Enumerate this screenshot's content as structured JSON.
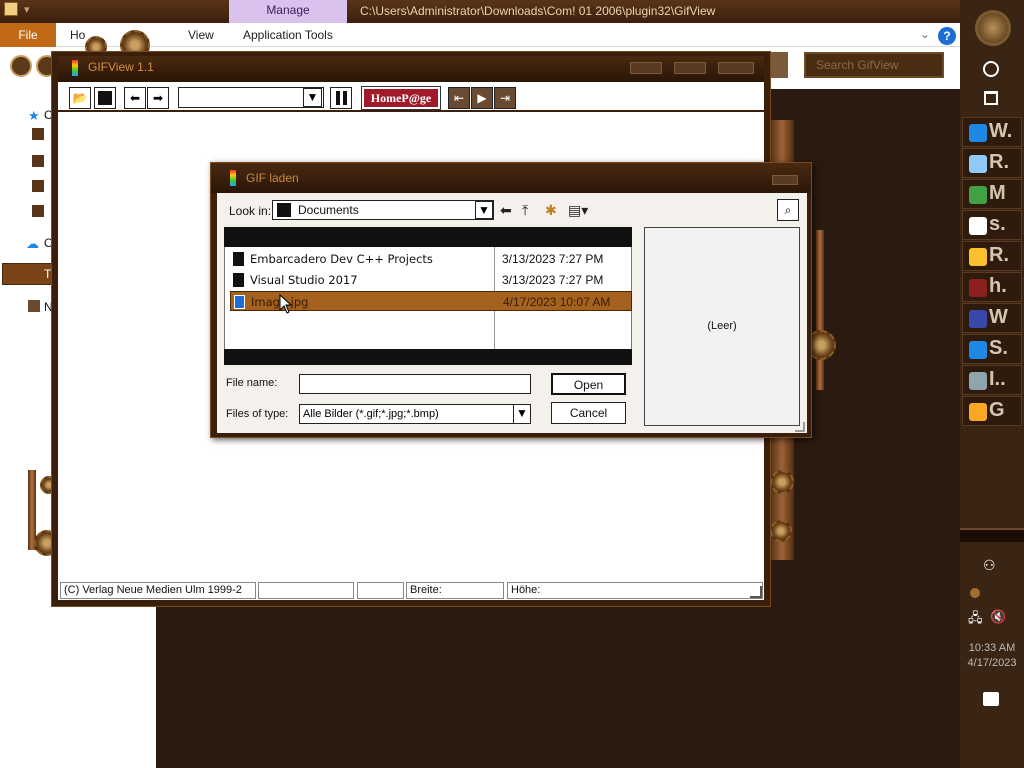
{
  "explorer": {
    "manage_tab": "Manage",
    "path_title": "C:\\Users\\Administrator\\Downloads\\Com! 01 2006\\plugin32\\GifView",
    "file_tab": "File",
    "view_tab": "View",
    "app_tools_tab": "Application Tools",
    "home_tab_partial": "Ho",
    "search_placeholder": "Search GifView",
    "help_label": "?",
    "left_items": [
      "C",
      "O",
      "T",
      "N"
    ]
  },
  "gifview": {
    "title": "GIFView 1.1",
    "homepage_label": "HomeP@ge",
    "status": {
      "copyright": "(C) Verlag Neue Medien Ulm 1999-2",
      "breite": "Breite:",
      "hoehe": "Höhe:"
    }
  },
  "dialog": {
    "title": "GIF laden",
    "lookin_label": "Look in:",
    "lookin_value": "Documents",
    "files": [
      {
        "name": "Embarcadero Dev C++ Projects",
        "date": "3/13/2023 7:27 PM"
      },
      {
        "name": "Visual Studio 2017",
        "date": "3/13/2023 7:27 PM"
      },
      {
        "name": "Image.jpg",
        "date": "4/17/2023 10:07 AM"
      }
    ],
    "preview_text": "(Leer)",
    "filename_label": "File name:",
    "filename_value": "",
    "filetype_label": "Files of type:",
    "filetype_value": "Alle Bilder (*.gif;*.jpg;*.bmp)",
    "open_label": "Open",
    "cancel_label": "Cancel"
  },
  "taskbar": {
    "apps": [
      {
        "letter": "W.",
        "color": "#1e88e5"
      },
      {
        "letter": "R.",
        "color": "#90caf9"
      },
      {
        "letter": "M",
        "color": "#43a047"
      },
      {
        "letter": "s.",
        "color": "#ffffff"
      },
      {
        "letter": "R.",
        "color": "#fbc02d"
      },
      {
        "letter": "h.",
        "color": "#8d1f1f"
      },
      {
        "letter": "W",
        "color": "#3949ab"
      },
      {
        "letter": "S.",
        "color": "#1e88e5"
      },
      {
        "letter": "I..",
        "color": "#90a4ae"
      },
      {
        "letter": "G",
        "color": "#f9a825"
      }
    ],
    "time": "10:33 AM",
    "date": "4/17/2023"
  },
  "colors": {
    "brown_dark": "#3a1f0c",
    "accent_orange": "#c06a16",
    "selected_row": "#a5621e",
    "manage_purple": "#d9c2ee"
  }
}
